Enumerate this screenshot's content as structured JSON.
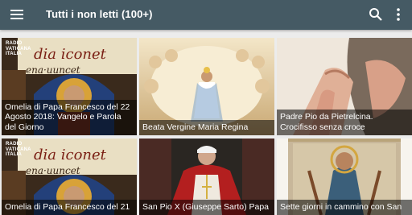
{
  "appbar": {
    "title": "Tutti i non letti (100+)",
    "icons": [
      "menu-icon",
      "search-icon",
      "more-vert-icon"
    ],
    "color": "#455a64"
  },
  "logo": {
    "line1": "RADIO",
    "line2": "VATICANA",
    "line3": "ITALIA"
  },
  "cards": [
    {
      "caption": "Omelia di Papa Francesco del 22 Agosto 2018: Vangelo e Parola del Giorno",
      "radio_logo": true
    },
    {
      "caption": "Beata Vergine Maria Regina"
    },
    {
      "caption": "Padre Pio da Pietrelcina. Crocifisso senza croce"
    },
    {
      "caption": "Omelia di Papa Francesco del 21",
      "radio_logo": true
    },
    {
      "caption": "San Pio X (Giuseppe Sarto) Papa"
    },
    {
      "caption": "Sette giorni in cammino con San"
    }
  ]
}
